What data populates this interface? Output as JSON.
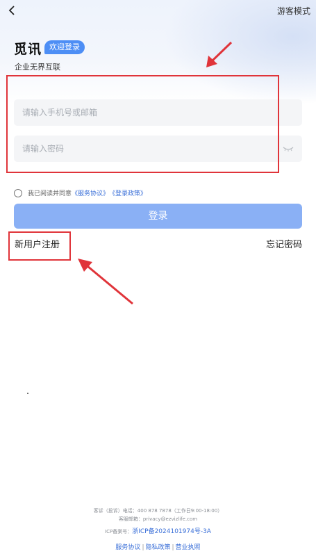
{
  "header": {
    "back_icon": "chevron-left-icon",
    "guest_mode_label": "游客模式"
  },
  "brand": {
    "name": "觅讯",
    "welcome_badge": "欢迎登录",
    "slogan": "企业无界互联"
  },
  "form": {
    "phone_placeholder": "请输入手机号或邮箱",
    "password_placeholder": "请输入密码",
    "eye_icon": "eye-closed-icon"
  },
  "agreement": {
    "prefix": "我已阅读并同意",
    "service_link": "《服务协议》",
    "privacy_link": "《登录政策》"
  },
  "actions": {
    "login_label": "登录",
    "register_label": "新用户注册",
    "forgot_label": "忘记密码"
  },
  "footer": {
    "complaint_line": "客诉（投诉）电话：400 878 7878（工作日9:00-18:00）",
    "email_line": "客服邮箱：privacy@ezvizlife.com",
    "icp_prefix": "ICP备案号：",
    "icp_number": "浙ICP备2024101974号-3A",
    "links": [
      "服务协议",
      "隐私政策",
      "营业执照"
    ]
  },
  "colors": {
    "accent": "#4d8ef5",
    "login_button": "#8ab0f5",
    "annotation": "#e0343a",
    "link": "#3a6fd8"
  }
}
